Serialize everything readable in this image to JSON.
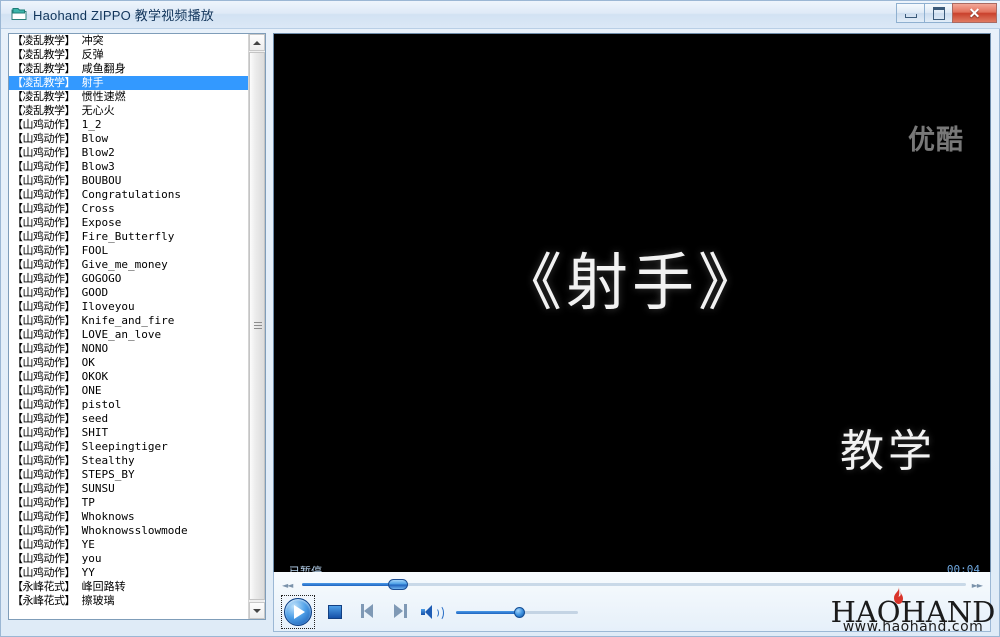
{
  "window": {
    "title": "Haohand ZIPPO 教学视频播放",
    "icon": "folder-window-icon",
    "minimize_label": "",
    "maximize_label": "",
    "close_label": "✕"
  },
  "playlist": {
    "selected_index": 3,
    "items": [
      {
        "tag": "【凌乱教学】",
        "name": "冲突"
      },
      {
        "tag": "【凌乱教学】",
        "name": "反弹"
      },
      {
        "tag": "【凌乱教学】",
        "name": "咸鱼翻身"
      },
      {
        "tag": "【凌乱教学】",
        "name": "射手"
      },
      {
        "tag": "【凌乱教学】",
        "name": "惯性速燃"
      },
      {
        "tag": "【凌乱教学】",
        "name": "无心火"
      },
      {
        "tag": "【山鸡动作】",
        "name": "1_2"
      },
      {
        "tag": "【山鸡动作】",
        "name": "Blow"
      },
      {
        "tag": "【山鸡动作】",
        "name": "Blow2"
      },
      {
        "tag": "【山鸡动作】",
        "name": "Blow3"
      },
      {
        "tag": "【山鸡动作】",
        "name": "BOUBOU"
      },
      {
        "tag": "【山鸡动作】",
        "name": "Congratulations"
      },
      {
        "tag": "【山鸡动作】",
        "name": "Cross"
      },
      {
        "tag": "【山鸡动作】",
        "name": "Expose"
      },
      {
        "tag": "【山鸡动作】",
        "name": "Fire_Butterfly"
      },
      {
        "tag": "【山鸡动作】",
        "name": "FOOL"
      },
      {
        "tag": "【山鸡动作】",
        "name": "Give_me_money"
      },
      {
        "tag": "【山鸡动作】",
        "name": "GOGOGO"
      },
      {
        "tag": "【山鸡动作】",
        "name": "GOOD"
      },
      {
        "tag": "【山鸡动作】",
        "name": "Iloveyou"
      },
      {
        "tag": "【山鸡动作】",
        "name": "Knife_and_fire"
      },
      {
        "tag": "【山鸡动作】",
        "name": "LOVE_an_love"
      },
      {
        "tag": "【山鸡动作】",
        "name": "NONO"
      },
      {
        "tag": "【山鸡动作】",
        "name": "OK"
      },
      {
        "tag": "【山鸡动作】",
        "name": "OKOK"
      },
      {
        "tag": "【山鸡动作】",
        "name": "ONE"
      },
      {
        "tag": "【山鸡动作】",
        "name": "pistol"
      },
      {
        "tag": "【山鸡动作】",
        "name": "seed"
      },
      {
        "tag": "【山鸡动作】",
        "name": "SHIT"
      },
      {
        "tag": "【山鸡动作】",
        "name": "Sleepingtiger"
      },
      {
        "tag": "【山鸡动作】",
        "name": "Stealthy"
      },
      {
        "tag": "【山鸡动作】",
        "name": "STEPS_BY"
      },
      {
        "tag": "【山鸡动作】",
        "name": "SUNSU"
      },
      {
        "tag": "【山鸡动作】",
        "name": "TP"
      },
      {
        "tag": "【山鸡动作】",
        "name": "Whoknows"
      },
      {
        "tag": "【山鸡动作】",
        "name": "Whoknowsslowmode"
      },
      {
        "tag": "【山鸡动作】",
        "name": "YE"
      },
      {
        "tag": "【山鸡动作】",
        "name": "you"
      },
      {
        "tag": "【山鸡动作】",
        "name": "YY"
      },
      {
        "tag": "【永峰花式】",
        "name": "峰回路转"
      },
      {
        "tag": "【永峰花式】",
        "name": "擦玻璃"
      }
    ]
  },
  "video": {
    "title": "《射手》",
    "subtitle": "教学",
    "watermark": "优酷",
    "background_color": "#000000"
  },
  "status": {
    "state_text": "已暂停",
    "time_text": "00:04",
    "state_color": "#b9d4ef",
    "time_color": "#6ea6dd"
  },
  "controls": {
    "rewind_glyph": "◄◄",
    "forward_glyph": "►►",
    "seek_percent": 14.5,
    "volume_percent": 52,
    "play_label": "play-button",
    "stop_label": "stop-button",
    "prev_label": "previous-button",
    "next_label": "next-button",
    "accent_color": "#1e64c0",
    "selection_color": "#3399ff"
  },
  "logo": {
    "main": "HAOHAND",
    "sub": "www.haohand.com",
    "flame_color": "#d9342b"
  }
}
